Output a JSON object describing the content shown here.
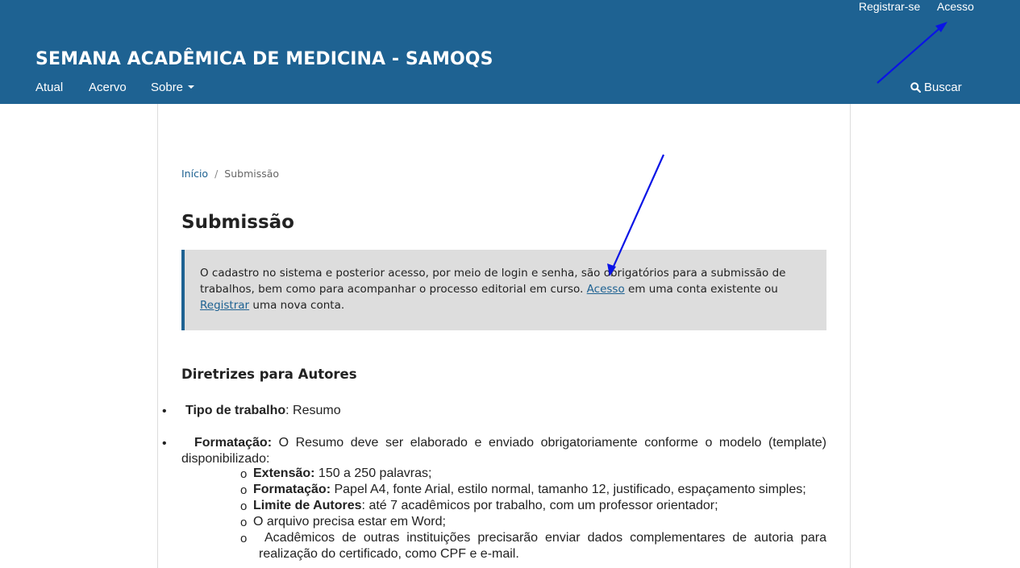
{
  "header": {
    "user_nav": {
      "register": "Registrar-se",
      "login": "Acesso"
    },
    "site_title": "SEMANA ACADÊMICA DE MEDICINA - SAMOQS",
    "nav": {
      "current": "Atual",
      "archive": "Acervo",
      "about": "Sobre"
    },
    "search": "Buscar"
  },
  "breadcrumb": {
    "home": "Início",
    "separator": "/",
    "current": "Submissão"
  },
  "page_title": "Submissão",
  "notice": {
    "text_1": "O cadastro no sistema e posterior acesso, por meio de login e senha, são obrigatórios para a submissão de trabalhos, bem como para acompanhar o processo editorial em curso. ",
    "login_link": "Acesso",
    "text_2": " em uma conta existente ou ",
    "register_link": "Registrar",
    "text_3": " uma nova conta."
  },
  "guidelines": {
    "title": "Diretrizes para Autores",
    "items": [
      {
        "label": "Tipo de trabalho",
        "text": ": Resumo"
      },
      {
        "label": "Formatação:",
        "text": " O Resumo deve ser elaborado e enviado obrigatoriamente conforme o modelo (template) disponibilizado:"
      }
    ],
    "sub_items": [
      {
        "label": "Extensão:",
        "text": " 150 a 250 palavras;"
      },
      {
        "label": "Formatação:",
        "text": " Papel A4, fonte Arial, estilo normal, tamanho 12, justificado, espaçamento simples;"
      },
      {
        "label": "Limite de Autores",
        "text": ": até 7 acadêmicos por trabalho, com um professor orientador;"
      },
      {
        "label": "",
        "text": "O arquivo precisa estar em Word;"
      },
      {
        "label": "",
        "text": "Acadêmicos de outras instituições precisarão enviar dados complementares de autoria para realização do certificado, como CPF e e-mail."
      }
    ],
    "bullet_glyph": "•",
    "sub_bullet_glyph": "o"
  },
  "colors": {
    "header_bg": "#1e6292",
    "link": "#1e6292",
    "notice_bg": "#dddddd",
    "annotation_arrow": "#0a14e6"
  }
}
